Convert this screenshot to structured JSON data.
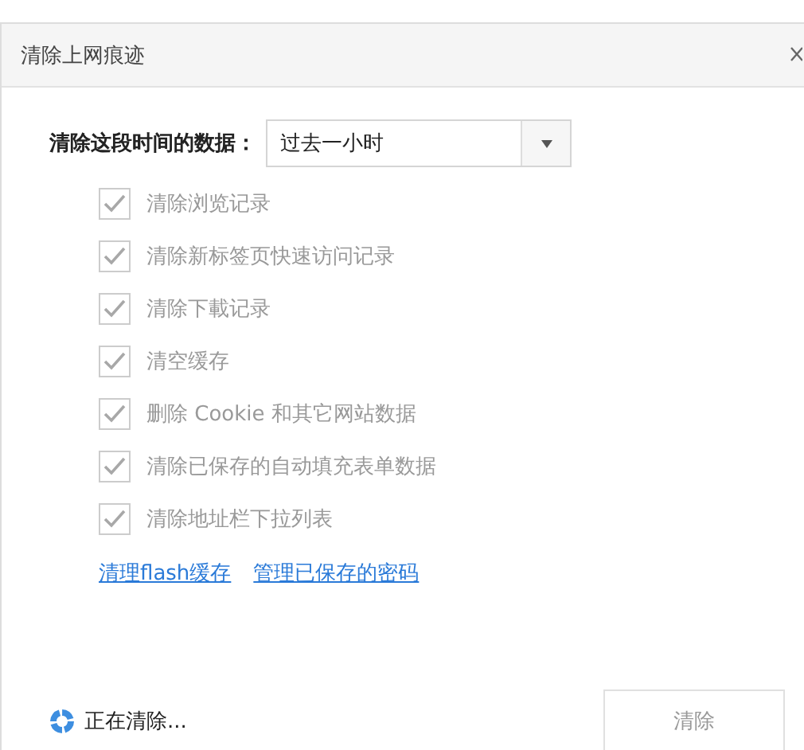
{
  "window": {
    "title": "清除上网痕迹"
  },
  "time_range": {
    "label": "清除这段时间的数据：",
    "value": "过去一小时"
  },
  "options": [
    {
      "label": "清除浏览记录",
      "checked": true,
      "disabled": true
    },
    {
      "label": "清除新标签页快速访问记录",
      "checked": true,
      "disabled": true
    },
    {
      "label": "清除下載记录",
      "checked": true,
      "disabled": true
    },
    {
      "label": "清空缓存",
      "checked": true,
      "disabled": true
    },
    {
      "label": "删除 Cookie 和其它网站数据",
      "checked": true,
      "disabled": true
    },
    {
      "label": "清除已保存的自动填充表单数据",
      "checked": true,
      "disabled": true
    },
    {
      "label": "清除地址栏下拉列表",
      "checked": true,
      "disabled": true
    }
  ],
  "links": [
    "清理flash缓存",
    "管理已保存的密码"
  ],
  "status": "正在清除...",
  "clear_button": {
    "label": "清除",
    "disabled": true
  }
}
